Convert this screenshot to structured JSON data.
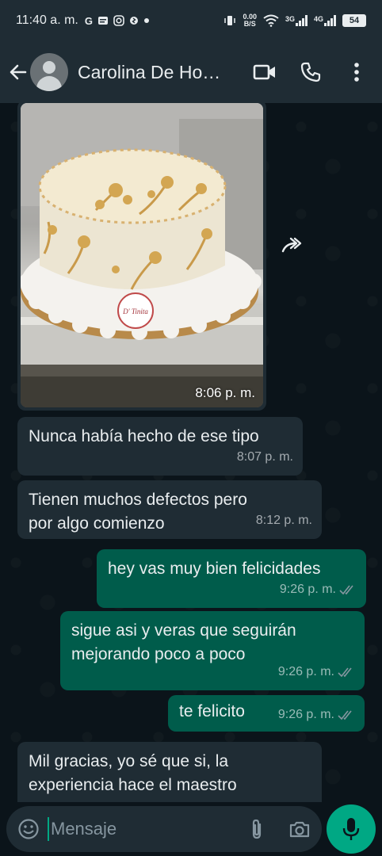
{
  "status_bar": {
    "time": "11:40 a. m.",
    "notif_icons": [
      "google-icon",
      "news-icon",
      "instagram-icon",
      "shazam-icon",
      "dot-icon"
    ],
    "net_speed_value": "0.00",
    "net_speed_unit": "B/S",
    "network_3g": "3G",
    "network_4g": "4G",
    "battery": "54"
  },
  "header": {
    "contact_name": "Carolina De Ho…"
  },
  "chat": {
    "image_message": {
      "time": "8:06 p. m."
    },
    "messages": [
      {
        "direction": "in",
        "text": "Nunca había hecho de ese tipo",
        "time": "8:07 p. m."
      },
      {
        "direction": "in",
        "text": "Tienen muchos defectos pero por algo comienzo",
        "time": "8:12 p. m."
      },
      {
        "direction": "out",
        "text": "hey vas muy bien felicidades",
        "time": "9:26 p. m.",
        "status": "read"
      },
      {
        "direction": "out",
        "text": "sigue asi y veras que seguirán mejorando poco a poco",
        "time": "9:26 p. m.",
        "status": "read"
      },
      {
        "direction": "out",
        "text": "te felicito",
        "time": "9:26 p. m.",
        "status": "read"
      },
      {
        "direction": "in",
        "text": "Mil gracias, yo sé que si, la experiencia hace el maestro",
        "time": ""
      }
    ],
    "cake_logo_text": "D' Tinita"
  },
  "input": {
    "placeholder": "Mensaje"
  },
  "colors": {
    "background": "#0b141a",
    "bar": "#1f2c34",
    "incoming": "#1f2c34",
    "outgoing": "#005c4b",
    "accent": "#00a884"
  }
}
